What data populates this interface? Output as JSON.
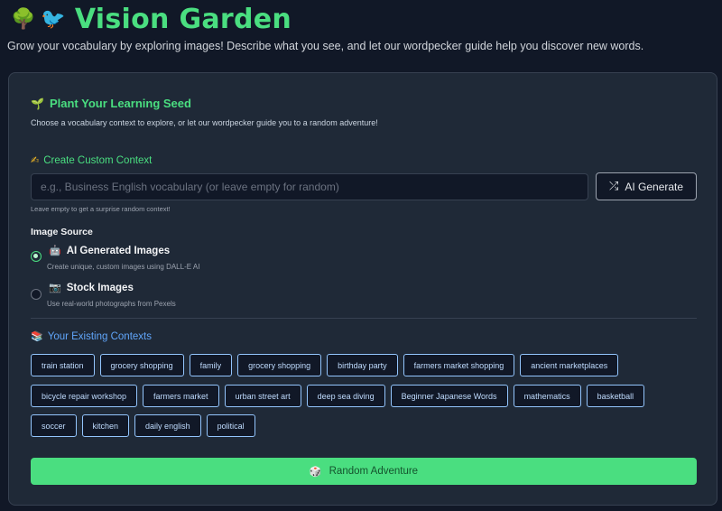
{
  "header": {
    "tree_icon": "🌳",
    "bird_icon": "🐦",
    "title": "Vision Garden",
    "subtitle": "Grow your vocabulary by exploring images! Describe what you see, and let our wordpecker guide help you discover new words."
  },
  "card": {
    "title_icon": "🌱",
    "title": "Plant Your Learning Seed",
    "description": "Choose a vocabulary context to explore, or let our wordpecker guide you to a random adventure!"
  },
  "custom_context": {
    "icon": "✍",
    "title": "Create Custom Context",
    "placeholder": "e.g., Business English vocabulary (or leave empty for random)",
    "value": "",
    "ai_button_icon": "⤮",
    "ai_button_label": "AI Generate",
    "hint": "Leave empty to get a surprise random context!"
  },
  "image_source": {
    "label": "Image Source",
    "options": [
      {
        "icon": "🤖",
        "label": "AI Generated Images",
        "description": "Create unique, custom images using DALL-E AI",
        "selected": true
      },
      {
        "icon": "📷",
        "label": "Stock Images",
        "description": "Use real-world photographs from Pexels",
        "selected": false
      }
    ]
  },
  "existing": {
    "icon": "📚",
    "title": "Your Existing Contexts",
    "rows": [
      [
        "train station",
        "grocery shopping",
        "family",
        "grocery shopping",
        "birthday party",
        "farmers market shopping",
        "ancient marketplaces"
      ],
      [
        "bicycle repair workshop",
        "farmers market",
        "urban street art",
        "deep sea diving",
        "Beginner Japanese Words",
        "mathematics",
        "basketball"
      ],
      [
        "soccer",
        "kitchen",
        "daily english",
        "political"
      ]
    ]
  },
  "random_button": {
    "icon": "🎲",
    "label": "Random Adventure"
  },
  "colors": {
    "accent_green": "#4ade80",
    "accent_blue": "#60a5fa",
    "background": "#111827",
    "card": "#1f2937"
  }
}
